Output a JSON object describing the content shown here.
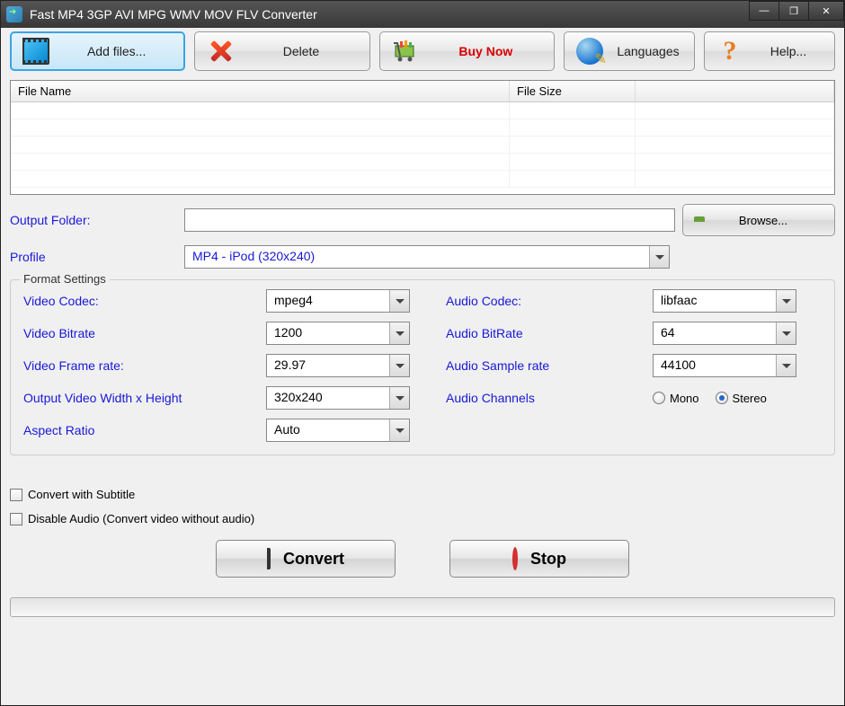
{
  "window": {
    "title": "Fast MP4 3GP AVI MPG WMV MOV FLV Converter"
  },
  "toolbar": {
    "add_files": "Add files...",
    "delete": "Delete",
    "buy_now": "Buy Now",
    "languages": "Languages",
    "help": "Help..."
  },
  "table": {
    "col_filename": "File Name",
    "col_filesize": "File Size"
  },
  "output": {
    "label": "Output Folder:",
    "value": "",
    "browse": "Browse..."
  },
  "profile": {
    "label": "Profile",
    "value": "MP4 - iPod (320x240)"
  },
  "format_settings": {
    "legend": "Format Settings",
    "video_codec_label": "Video Codec:",
    "video_codec": "mpeg4",
    "video_bitrate_label": "Video Bitrate",
    "video_bitrate": "1200",
    "video_framerate_label": "Video Frame rate:",
    "video_framerate": "29.97",
    "output_size_label": "Output Video Width x Height",
    "output_size": "320x240",
    "aspect_label": "Aspect Ratio",
    "aspect": "Auto",
    "audio_codec_label": "Audio Codec:",
    "audio_codec": "libfaac",
    "audio_bitrate_label": "Audio BitRate",
    "audio_bitrate": "64",
    "audio_sample_label": "Audio Sample rate",
    "audio_sample": "44100",
    "audio_channels_label": "Audio Channels",
    "mono": "Mono",
    "stereo": "Stereo"
  },
  "checkboxes": {
    "subtitle": "Convert with Subtitle",
    "disable_audio": "Disable Audio (Convert video without audio)"
  },
  "actions": {
    "convert": "Convert",
    "stop": "Stop"
  }
}
